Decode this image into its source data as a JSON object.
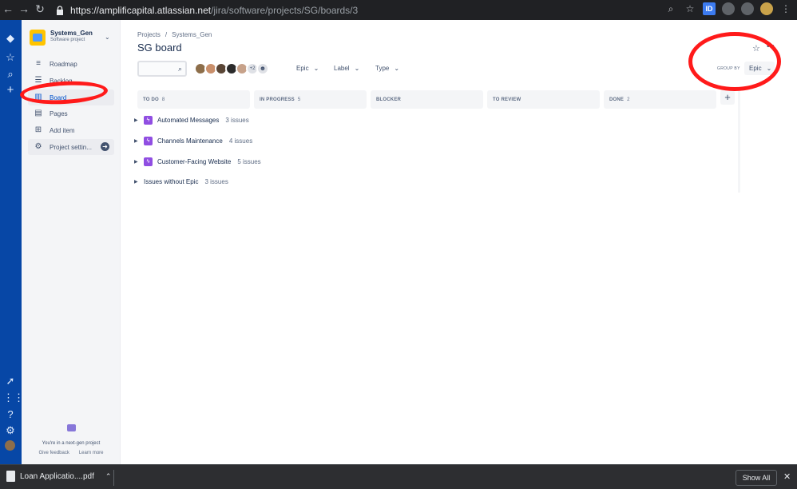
{
  "browser": {
    "url_host": "https://amplificapital.atlassian.net",
    "url_path": "/jira/software/projects/SG/boards/3",
    "back_icon": "arrow-left",
    "forward_icon": "arrow-right",
    "ext_label": "ID"
  },
  "global_nav": {
    "items": [
      "jira-logo",
      "star",
      "search",
      "create",
      "rocket",
      "apps",
      "help",
      "settings",
      "profile"
    ]
  },
  "sidebar": {
    "project_name": "Systems_Gen",
    "project_type": "Software project",
    "items": [
      {
        "label": "Roadmap",
        "icon": "roadmap-icon"
      },
      {
        "label": "Backlog",
        "icon": "backlog-icon"
      },
      {
        "label": "Board",
        "icon": "board-icon"
      },
      {
        "label": "Pages",
        "icon": "pages-icon"
      },
      {
        "label": "Add item",
        "icon": "add-item-icon"
      },
      {
        "label": "Project settin...",
        "icon": "settings-icon"
      }
    ],
    "next_gen_text": "You're in a next-gen project",
    "give_feedback": "Give feedback",
    "learn_more": "Learn more"
  },
  "main": {
    "breadcrumb": [
      "Projects",
      "/",
      "Systems_Gen"
    ],
    "title": "SG board",
    "avatars_more": "+2",
    "filters": [
      "Epic",
      "Label",
      "Type"
    ],
    "group_by_label": "GROUP BY",
    "group_by_value": "Epic",
    "columns": [
      {
        "name": "TO DO",
        "count": "8"
      },
      {
        "name": "IN PROGRESS",
        "count": "5"
      },
      {
        "name": "BLOCKER",
        "count": ""
      },
      {
        "name": "TO REVIEW",
        "count": ""
      },
      {
        "name": "DONE",
        "count": "2"
      }
    ],
    "epics": [
      {
        "name": "Automated Messages",
        "issues": "3 issues"
      },
      {
        "name": "Channels Maintenance",
        "issues": "4 issues"
      },
      {
        "name": "Customer-Facing Website",
        "issues": "5 issues"
      }
    ],
    "no_epic": {
      "name": "Issues without Epic",
      "issues": "3 issues"
    }
  },
  "download_bar": {
    "file_name": "Loan Applicatio....pdf",
    "show_all": "Show All"
  },
  "colors": {
    "global_nav": "#0747a6",
    "sidebar_bg": "#f4f5f7",
    "epic_purple": "#904ee2",
    "annotation_red": "#ff1a1a"
  }
}
